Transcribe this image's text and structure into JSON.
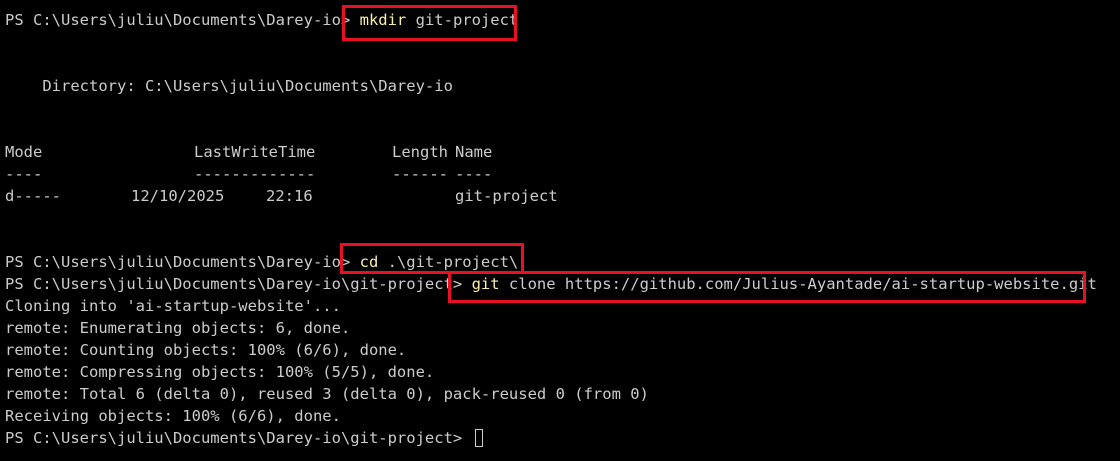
{
  "terminal": {
    "prompt1": "PS C:\\Users\\juliu\\Documents\\Darey-io> ",
    "cmd1_word": "mkdir",
    "cmd1_args": " git-project",
    "directory_line": "    Directory: C:\\Users\\juliu\\Documents\\Darey-io",
    "table": {
      "header": [
        "Mode",
        "LastWriteTime",
        "Length",
        "Name"
      ],
      "divider": [
        "----",
        "-------------",
        "------",
        "----"
      ],
      "row": {
        "mode": "d-----",
        "date": "12/10/2025",
        "time": "22:16",
        "length": "",
        "name": "git-project"
      }
    },
    "prompt2": "PS C:\\Users\\juliu\\Documents\\Darey-io> ",
    "cmd2_word": "cd",
    "cmd2_args": " .\\git-project\\",
    "prompt3": "PS C:\\Users\\juliu\\Documents\\Darey-io\\git-project> ",
    "cmd3_word": "git",
    "cmd3_args": " clone https://github.com/Julius-Ayantade/ai-startup-website.git",
    "output": [
      "Cloning into 'ai-startup-website'...",
      "remote: Enumerating objects: 6, done.",
      "remote: Counting objects: 100% (6/6), done.",
      "remote: Compressing objects: 100% (5/5), done.",
      "remote: Total 6 (delta 0), reused 3 (delta 0), pack-reused 0 (from 0)",
      "Receiving objects: 100% (6/6), done."
    ],
    "prompt4": "PS C:\\Users\\juliu\\Documents\\Darey-io\\git-project> "
  },
  "colors": {
    "background": "#000000",
    "text": "#cccccc",
    "command": "#f9f1a5",
    "highlight_box": "#e81123"
  }
}
